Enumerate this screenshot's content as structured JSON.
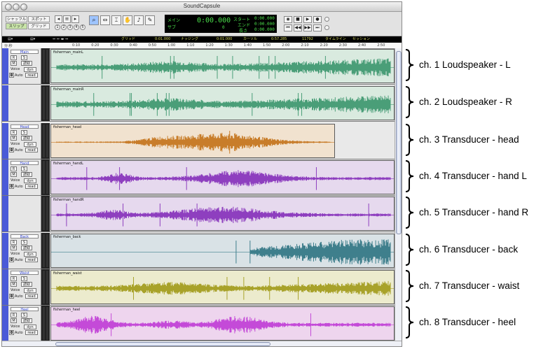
{
  "window": {
    "title": "SoundCapsule"
  },
  "modes": {
    "shuffle": "シャッフル",
    "spot": "スポット",
    "slip": "スリップ",
    "grid": "グリッド"
  },
  "counter": {
    "main_label": "メイン",
    "sub_label": "サブ",
    "main_value": "0:00.000",
    "sub_value": "0",
    "start_label": "スタート",
    "end_label": "エンド",
    "length_label": "長さ",
    "start_value": "0:00.000",
    "end_value": "0:00.000",
    "length_value": "0:00.000"
  },
  "rulerbar": {
    "grid_label": "グリッド",
    "grid_value": "0:01.000",
    "nudge_label": "ナッジング",
    "nudge_value": "0:01.000",
    "cursor_label": "カーソル",
    "cursor_value": "0:57.285",
    "sample_value": "11792",
    "timeline_label": "タイムライン",
    "session_label": "セッション"
  },
  "ruler": {
    "min_sec_label": "分:秒",
    "ticks": [
      "0:10",
      "0:20",
      "0:30",
      "0:40",
      "0:50",
      "1:00",
      "1:10",
      "1:20",
      "1:30",
      "1:40",
      "1:50",
      "2:00",
      "2:10",
      "2:20",
      "2:30",
      "2:40",
      "2:50"
    ]
  },
  "track_controls": {
    "rec": "R",
    "solo": "S",
    "mute": "M",
    "readonly": "読取",
    "voice_label": "Voice",
    "voice_value": "dyn",
    "auto_label": "Auto",
    "auto_value": "read"
  },
  "tracks": [
    {
      "name": "Main",
      "clip_label": "fisherman_mainL",
      "label": "ch. 1  Loudspeaker - L",
      "color": "#d9eadf",
      "wave": "#4a9e78",
      "with_header": true
    },
    {
      "name": "",
      "clip_label": "fisherman_mainR",
      "label": "ch. 2  Loudspeaker - R",
      "color": "#d9eadf",
      "wave": "#4a9e78",
      "with_header": false
    },
    {
      "name": "Head",
      "clip_label": "fisherman_head",
      "label": "ch. 3  Transducer - head",
      "color": "#f1e2cf",
      "wave": "#c87d2a",
      "with_header": true
    },
    {
      "name": "Hand",
      "clip_label": "fisherman_handL",
      "label": "ch. 4  Transducer - hand L",
      "color": "#e6d9ee",
      "wave": "#8e3fbf",
      "with_header": true
    },
    {
      "name": "",
      "clip_label": "fisherman_handR",
      "label": "ch. 5  Transducer - hand R",
      "color": "#e6d9ee",
      "wave": "#8e3fbf",
      "with_header": false
    },
    {
      "name": "Back",
      "clip_label": "fisherman_back",
      "label": "ch. 6  Transducer - back",
      "color": "#d9e2e6",
      "wave": "#3f7f8c",
      "with_header": true
    },
    {
      "name": "Waist",
      "clip_label": "fisherman_waist",
      "label": "ch. 7  Transducer - waist",
      "color": "#ecebcd",
      "wave": "#a8a22a",
      "with_header": true
    },
    {
      "name": "Heel",
      "clip_label": "fisherman_heel",
      "label": "ch. 8  Transducer - heel",
      "color": "#eed5ee",
      "wave": "#c44ad8",
      "with_header": true
    }
  ]
}
